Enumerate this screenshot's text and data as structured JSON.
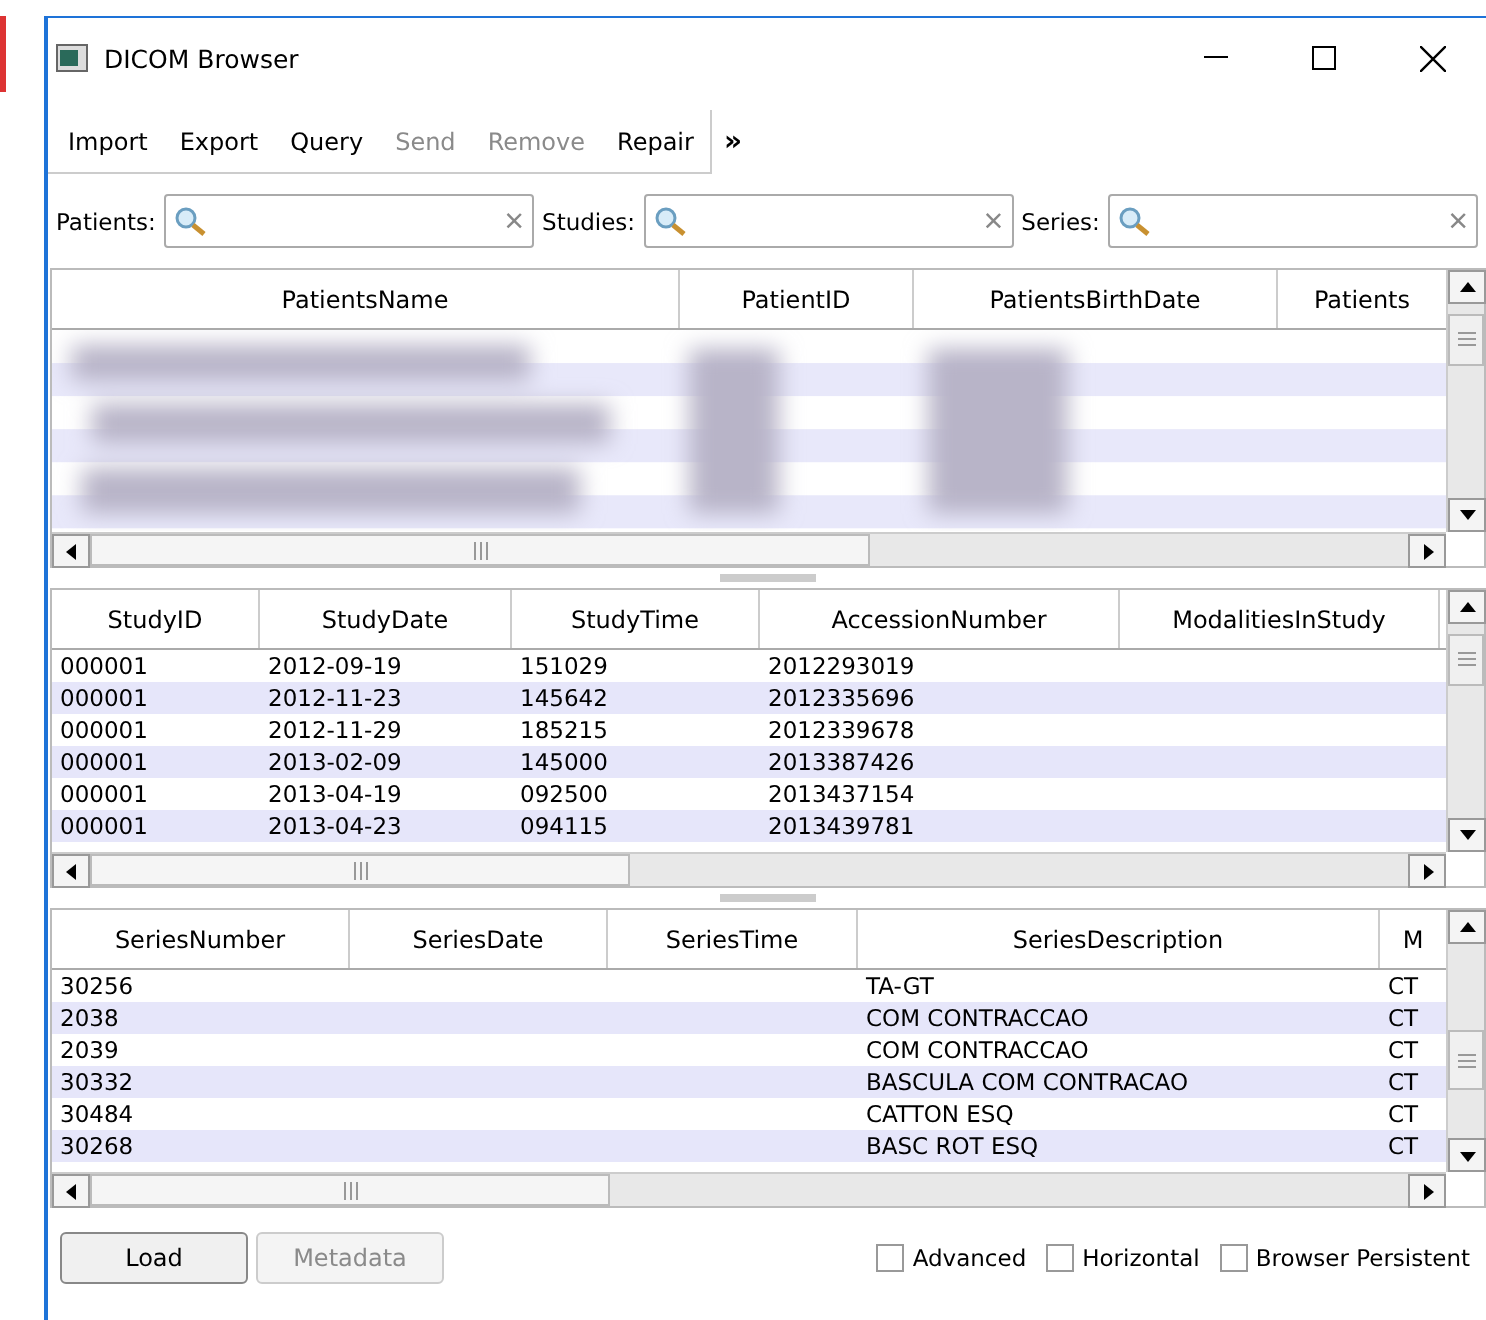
{
  "window": {
    "title": "DICOM Browser"
  },
  "toolbar": {
    "items": [
      {
        "label": "Import",
        "disabled": false
      },
      {
        "label": "Export",
        "disabled": false
      },
      {
        "label": "Query",
        "disabled": false
      },
      {
        "label": "Send",
        "disabled": true
      },
      {
        "label": "Remove",
        "disabled": true
      },
      {
        "label": "Repair",
        "disabled": false
      }
    ],
    "overflow": "»"
  },
  "filters": [
    {
      "label": "Patients:",
      "clear": "×"
    },
    {
      "label": "Studies:",
      "clear": "×"
    },
    {
      "label": "Series:",
      "clear": "×"
    }
  ],
  "patients_table": {
    "columns": [
      "PatientsName",
      "PatientID",
      "PatientsBirthDate",
      "Patients"
    ],
    "rows_redacted": true
  },
  "studies_table": {
    "columns": [
      "StudyID",
      "StudyDate",
      "StudyTime",
      "AccessionNumber",
      "ModalitiesInStudy"
    ],
    "rows": [
      [
        "000001",
        "2012-09-19",
        "151029",
        "2012293019",
        ""
      ],
      [
        "000001",
        "2012-11-23",
        "145642",
        "2012335696",
        ""
      ],
      [
        "000001",
        "2012-11-29",
        "185215",
        "2012339678",
        ""
      ],
      [
        "000001",
        "2013-02-09",
        "145000",
        "2013387426",
        ""
      ],
      [
        "000001",
        "2013-04-19",
        "092500",
        "2013437154",
        ""
      ],
      [
        "000001",
        "2013-04-23",
        "094115",
        "2013439781",
        ""
      ]
    ]
  },
  "series_table": {
    "columns": [
      "SeriesNumber",
      "SeriesDate",
      "SeriesTime",
      "SeriesDescription",
      "M"
    ],
    "rows": [
      [
        "30256",
        "",
        "",
        "TA-GT",
        "CT"
      ],
      [
        "2038",
        "",
        "",
        "COM CONTRACCAO",
        "CT"
      ],
      [
        "2039",
        "",
        "",
        "COM CONTRACCAO",
        "CT"
      ],
      [
        "30332",
        "",
        "",
        "BASCULA COM CONTRACAO",
        "CT"
      ],
      [
        "30484",
        "",
        "",
        "CATTON ESQ",
        "CT"
      ],
      [
        "30268",
        "",
        "",
        "BASC ROT ESQ",
        "CT"
      ]
    ]
  },
  "buttons": [
    {
      "label": "Load",
      "disabled": false
    },
    {
      "label": "Metadata",
      "disabled": true
    }
  ],
  "options": [
    {
      "label": "Advanced",
      "checked": false
    },
    {
      "label": "Horizontal",
      "checked": false
    },
    {
      "label": "Browser Persistent",
      "checked": false
    }
  ]
}
